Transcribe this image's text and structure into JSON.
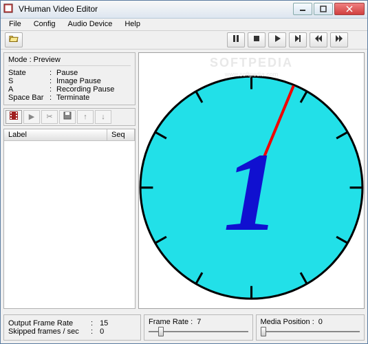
{
  "window": {
    "title": "VHuman Video Editor"
  },
  "menu": {
    "file": "File",
    "config": "Config",
    "audio_device": "Audio Device",
    "help": "Help"
  },
  "mode_panel": {
    "header": "Mode : Preview",
    "rows": {
      "state": {
        "k": "State",
        "v": "Pause"
      },
      "s": {
        "k": "S",
        "v": "Image Pause"
      },
      "a": {
        "k": "A",
        "v": "Recording Pause"
      },
      "space": {
        "k": "Space Bar",
        "v": "Terminate"
      }
    }
  },
  "list": {
    "col_label": "Label",
    "col_seq": "Seq"
  },
  "bottom": {
    "output_rate_label": "Output Frame Rate",
    "output_rate_value": "15",
    "skipped_label": "Skipped frames / sec",
    "skipped_value": "0",
    "frame_rate_label": "Frame Rate :",
    "frame_rate_value": "7",
    "media_pos_label": "Media Position :",
    "media_pos_value": "0"
  },
  "watermark": {
    "line1": "SOFTPEDIA",
    "line2": "www.softpedia.com"
  },
  "countdown_digit": "1"
}
